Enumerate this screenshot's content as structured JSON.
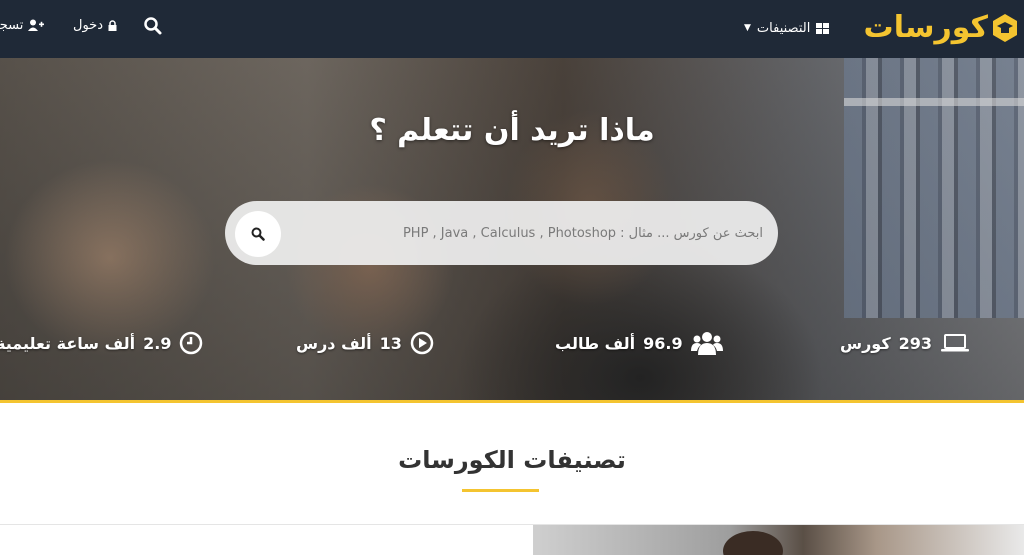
{
  "brand": {
    "name": "كورسات",
    "color": "#f4c430"
  },
  "nav": {
    "categories_label": "التصنيفات",
    "login_label": "دخول",
    "register_label": "تسجيل",
    "icons": {
      "categories": "grid-icon",
      "search": "search-icon",
      "login": "lock-icon",
      "register": "user-plus-icon"
    }
  },
  "hero": {
    "title": "ماذا تريد أن تتعلم ؟",
    "search_placeholder": "ابحث عن كورس ... مثال : PHP , Java , Calculus , Photoshop",
    "stats": [
      {
        "icon": "laptop-icon",
        "value": "293",
        "label": "كورس"
      },
      {
        "icon": "users-icon",
        "value": "96.9",
        "label": "ألف طالب"
      },
      {
        "icon": "play-icon",
        "value": "13",
        "label": "ألف درس"
      },
      {
        "icon": "clock-icon",
        "value": "2.9",
        "label": "ألف ساعة تعليمية"
      }
    ]
  },
  "section": {
    "title": "تصنيفات الكورسات"
  },
  "colors": {
    "navbar": "#1f2937",
    "accent": "#f4c430"
  }
}
